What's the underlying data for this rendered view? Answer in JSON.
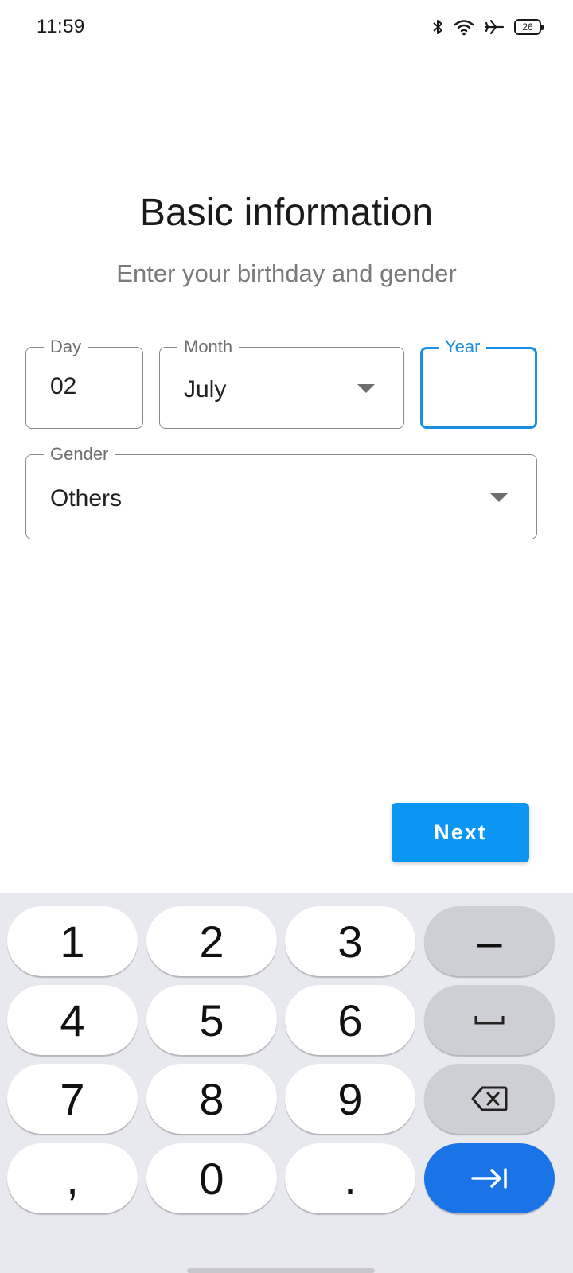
{
  "status_bar": {
    "time": "11:59",
    "battery_level": "26",
    "icons": [
      "bluetooth-icon",
      "wifi-icon",
      "airplane-mode-icon",
      "battery-icon"
    ]
  },
  "header": {
    "title": "Basic information",
    "subtitle": "Enter your birthday and gender"
  },
  "form": {
    "day": {
      "label": "Day",
      "value": "02"
    },
    "month": {
      "label": "Month",
      "value": "July"
    },
    "year": {
      "label": "Year",
      "value": ""
    },
    "gender": {
      "label": "Gender",
      "value": "Others"
    }
  },
  "actions": {
    "next_label": "Next"
  },
  "keyboard": {
    "keys": [
      {
        "label": "1"
      },
      {
        "label": "2"
      },
      {
        "label": "3"
      },
      {
        "label": "–"
      },
      {
        "label": "4"
      },
      {
        "label": "5"
      },
      {
        "label": "6"
      },
      {
        "label": "␣",
        "icon": "space-icon"
      },
      {
        "label": "7"
      },
      {
        "label": "8"
      },
      {
        "label": "9"
      },
      {
        "label": "",
        "icon": "backspace-icon"
      },
      {
        "label": ","
      },
      {
        "label": "0"
      },
      {
        "label": "."
      },
      {
        "label": "",
        "icon": "tab-next-icon"
      }
    ]
  },
  "colors": {
    "accent": "#0a96f2",
    "focus": "#1a8fe3",
    "keyboard_action": "#1b73e8",
    "keyboard_bg": "#e8e9ee"
  }
}
